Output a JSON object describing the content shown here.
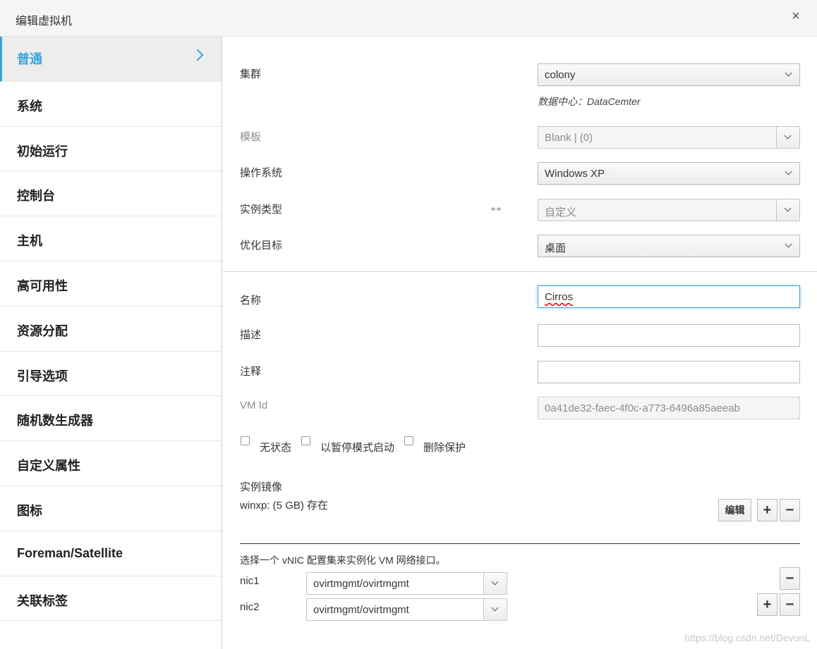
{
  "dialog": {
    "title": "编辑虚拟机",
    "close_label": "×"
  },
  "sidebar": {
    "items": [
      {
        "label": "普通",
        "active": true
      },
      {
        "label": "系统"
      },
      {
        "label": "初始运行"
      },
      {
        "label": "控制台"
      },
      {
        "label": "主机"
      },
      {
        "label": "高可用性"
      },
      {
        "label": "资源分配"
      },
      {
        "label": "引导选项"
      },
      {
        "label": "随机数生成器"
      },
      {
        "label": "自定义属性"
      },
      {
        "label": "图标"
      },
      {
        "label": "Foreman/Satellite"
      },
      {
        "label": "关联标签"
      }
    ]
  },
  "general": {
    "cluster_label": "集群",
    "cluster_value": "colony",
    "datacenter_text": "数据中心：DataCemter",
    "template_label": "模板",
    "template_value": "Blank |  (0)",
    "os_label": "操作系统",
    "os_value": "Windows XP",
    "instance_type_label": "实例类型",
    "instance_type_value": "自定义",
    "optimize_label": "优化目标",
    "optimize_value": "桌面",
    "name_label": "名称",
    "name_value": "Cirros",
    "description_label": "描述",
    "description_value": "",
    "comment_label": "注释",
    "comment_value": "",
    "vmid_label": "VM Id",
    "vmid_value": "0a41de32-faec-4f0c-a773-6496a85aeeab",
    "checkbox_stateless": "无状态",
    "checkbox_paused": "以暂停模式启动",
    "checkbox_delete_protection": "删除保护",
    "instance_images_label": "实例镜像",
    "instance_images_value": "winxp: (5 GB) 存在",
    "edit_button": "编辑",
    "plus": "+",
    "minus": "−",
    "vnic_instruction": "选择一个 vNIC 配置集来实例化 VM 网络接口。",
    "nics": [
      {
        "label": "nic1",
        "value": "ovirtmgmt/ovirtmgmt"
      },
      {
        "label": "nic2",
        "value": "ovirtmgmt/ovirtmgmt"
      }
    ]
  },
  "watermark": "https://blog.csdn.net/DevonL"
}
